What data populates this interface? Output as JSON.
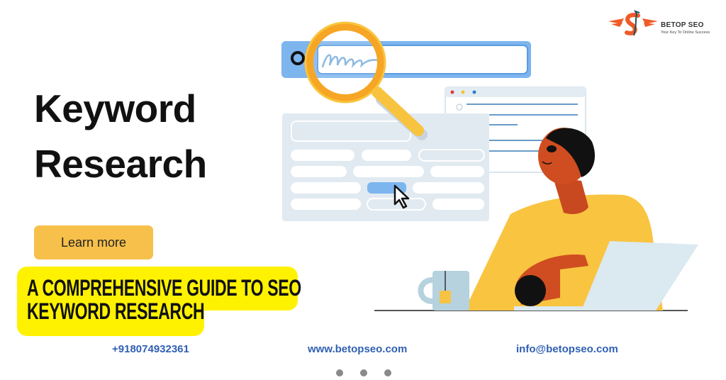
{
  "brand": {
    "name": "BETOP SEO",
    "tagline": "Your Key To Online Success",
    "colors": {
      "logo_orange": "#f05a28",
      "logo_teal": "#1d4f5c"
    }
  },
  "hero": {
    "title_line1": "Keyword",
    "title_line2": "Research",
    "cta_label": "Learn more"
  },
  "guide": {
    "line1": "A Comprehensive Guide to SEO",
    "line2": "Keyword Research"
  },
  "contact": {
    "phone": "+918074932361",
    "website": "www.betopseo.com",
    "email": "info@betopseo.com"
  },
  "carousel": {
    "slide_count": 3
  },
  "colors": {
    "accent_yellow": "#fff200",
    "button_yellow": "#f7c04a",
    "link_blue": "#2f5fb3",
    "search_blue": "#7db5ee"
  }
}
